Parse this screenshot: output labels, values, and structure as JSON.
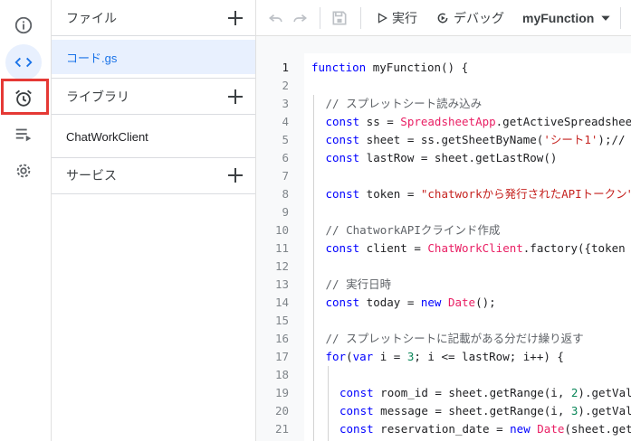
{
  "rail": {
    "items": [
      {
        "name": "info-icon",
        "active": false
      },
      {
        "name": "code-icon",
        "active": true
      },
      {
        "name": "alarm-clock-icon",
        "active": false
      },
      {
        "name": "executions-list-icon",
        "active": false
      },
      {
        "name": "settings-gear-icon",
        "active": false
      }
    ]
  },
  "panel": {
    "files_header": "ファイル",
    "files": [
      "コード.gs"
    ],
    "libraries_header": "ライブラリ",
    "libraries": [
      "ChatWorkClient"
    ],
    "services_header": "サービス"
  },
  "toolbar": {
    "run_label": "実行",
    "debug_label": "デバッグ",
    "function_name": "myFunction"
  },
  "editor": {
    "current_line": 1,
    "lines": [
      {
        "n": "1",
        "indent": 0,
        "tokens": [
          {
            "t": "function",
            "c": "kw"
          },
          {
            "t": " myFunction() {",
            "c": "fn"
          }
        ]
      },
      {
        "n": "2",
        "indent": 0,
        "tokens": []
      },
      {
        "n": "3",
        "indent": 1,
        "tokens": [
          {
            "t": "// スプレットシート読み込み",
            "c": "cm"
          }
        ]
      },
      {
        "n": "4",
        "indent": 1,
        "tokens": [
          {
            "t": "const",
            "c": "kw"
          },
          {
            "t": " ss = ",
            "c": "fn"
          },
          {
            "t": "SpreadsheetApp",
            "c": "cls"
          },
          {
            "t": ".getActiveSpreadsheet();",
            "c": "fn"
          }
        ]
      },
      {
        "n": "5",
        "indent": 1,
        "tokens": [
          {
            "t": "const",
            "c": "kw"
          },
          {
            "t": " sheet = ss.getSheetByName(",
            "c": "fn"
          },
          {
            "t": "'シート1'",
            "c": "str"
          },
          {
            "t": ");//",
            "c": "fn"
          }
        ]
      },
      {
        "n": "6",
        "indent": 1,
        "tokens": [
          {
            "t": "const",
            "c": "kw"
          },
          {
            "t": " lastRow = sheet.getLastRow()",
            "c": "fn"
          }
        ]
      },
      {
        "n": "7",
        "indent": 1,
        "tokens": []
      },
      {
        "n": "8",
        "indent": 1,
        "tokens": [
          {
            "t": "const",
            "c": "kw"
          },
          {
            "t": " token = ",
            "c": "fn"
          },
          {
            "t": "\"chatworkから発行されたAPIトークン\"",
            "c": "str"
          }
        ]
      },
      {
        "n": "9",
        "indent": 1,
        "tokens": []
      },
      {
        "n": "10",
        "indent": 1,
        "tokens": [
          {
            "t": "// ChatworkAPIクラインド作成",
            "c": "cm"
          }
        ]
      },
      {
        "n": "11",
        "indent": 1,
        "tokens": [
          {
            "t": "const",
            "c": "kw"
          },
          {
            "t": " client = ",
            "c": "fn"
          },
          {
            "t": "ChatWorkClient",
            "c": "cls"
          },
          {
            "t": ".factory({token",
            "c": "fn"
          }
        ]
      },
      {
        "n": "12",
        "indent": 1,
        "tokens": []
      },
      {
        "n": "13",
        "indent": 1,
        "tokens": [
          {
            "t": "// 実行日時",
            "c": "cm"
          }
        ]
      },
      {
        "n": "14",
        "indent": 1,
        "tokens": [
          {
            "t": "const",
            "c": "kw"
          },
          {
            "t": " today = ",
            "c": "fn"
          },
          {
            "t": "new",
            "c": "kw"
          },
          {
            "t": " ",
            "c": "fn"
          },
          {
            "t": "Date",
            "c": "cls"
          },
          {
            "t": "();",
            "c": "fn"
          }
        ]
      },
      {
        "n": "15",
        "indent": 1,
        "tokens": []
      },
      {
        "n": "16",
        "indent": 1,
        "tokens": [
          {
            "t": "// スプレットシートに記載がある分だけ繰り返す",
            "c": "cm"
          }
        ]
      },
      {
        "n": "17",
        "indent": 1,
        "tokens": [
          {
            "t": "for",
            "c": "kw"
          },
          {
            "t": "(",
            "c": "fn"
          },
          {
            "t": "var",
            "c": "kw"
          },
          {
            "t": " i = ",
            "c": "fn"
          },
          {
            "t": "3",
            "c": "num"
          },
          {
            "t": "; i <= lastRow; i++) {",
            "c": "fn"
          }
        ]
      },
      {
        "n": "18",
        "indent": 2,
        "tokens": []
      },
      {
        "n": "19",
        "indent": 2,
        "tokens": [
          {
            "t": "const",
            "c": "kw"
          },
          {
            "t": " room_id = sheet.getRange(i, ",
            "c": "fn"
          },
          {
            "t": "2",
            "c": "num"
          },
          {
            "t": ").getValue();",
            "c": "fn"
          }
        ]
      },
      {
        "n": "20",
        "indent": 2,
        "tokens": [
          {
            "t": "const",
            "c": "kw"
          },
          {
            "t": " message = sheet.getRange(i, ",
            "c": "fn"
          },
          {
            "t": "3",
            "c": "num"
          },
          {
            "t": ").getValue();",
            "c": "fn"
          }
        ]
      },
      {
        "n": "21",
        "indent": 2,
        "tokens": [
          {
            "t": "const",
            "c": "kw"
          },
          {
            "t": " reservation_date = ",
            "c": "fn"
          },
          {
            "t": "new",
            "c": "kw"
          },
          {
            "t": " ",
            "c": "fn"
          },
          {
            "t": "Date",
            "c": "cls"
          },
          {
            "t": "(sheet.getRange",
            "c": "fn"
          }
        ]
      }
    ]
  },
  "colors": {
    "accent": "#1a73e8",
    "active_bg": "#e8f0fe",
    "highlight_box": "#e53935",
    "keyword": "#0000ff",
    "class": "#e91e63",
    "string": "#c5221f",
    "comment": "#5f6368",
    "number": "#098658"
  }
}
